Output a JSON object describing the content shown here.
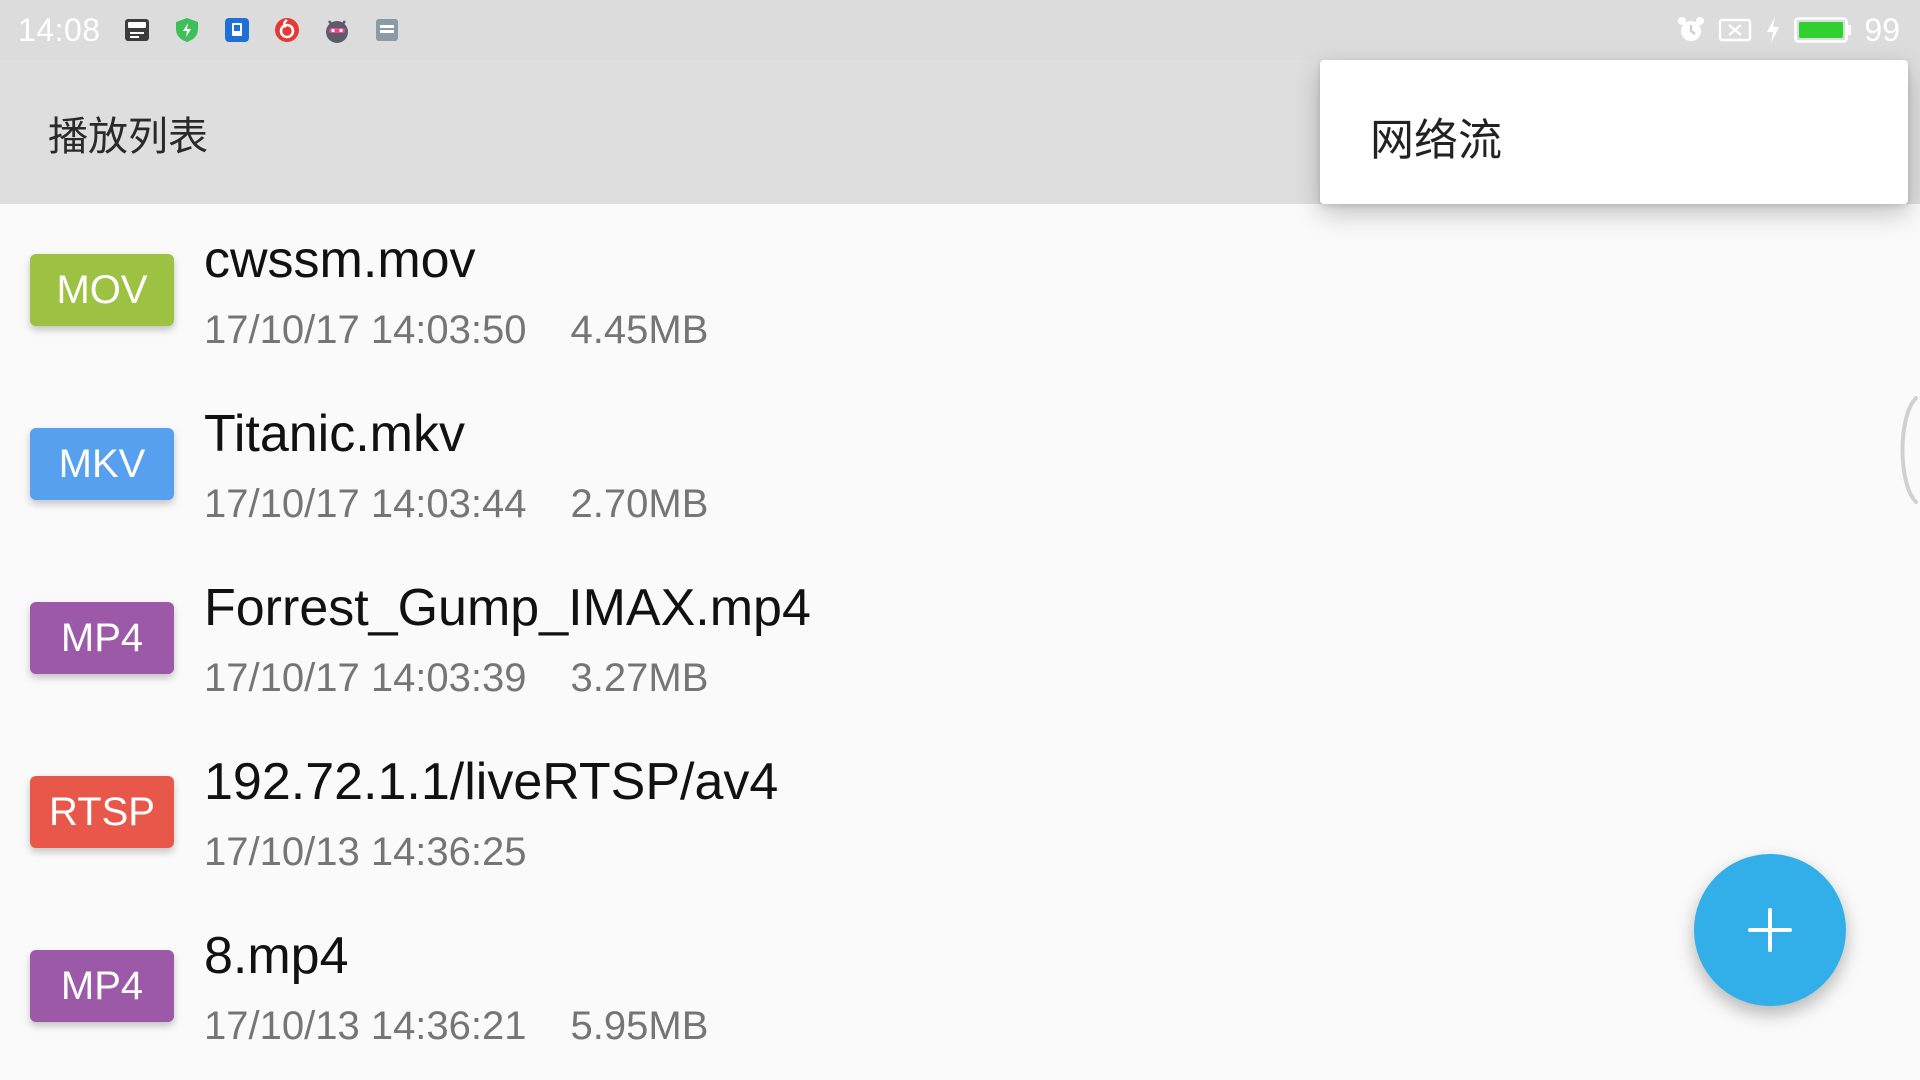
{
  "status_bar": {
    "time": "14:08",
    "notification_icons": [
      "usb-debug-icon",
      "security-shield-icon",
      "blue-app-icon",
      "netease-music-icon",
      "android-bot-icon",
      "gallery-icon"
    ],
    "right_icons": [
      "alarm-icon",
      "no-sim-icon",
      "charging-bolt-icon",
      "battery-icon"
    ],
    "battery_percent": "99",
    "battery_color": "#2ed12e"
  },
  "app_bar": {
    "title": "播放列表"
  },
  "overflow_menu": {
    "items": [
      {
        "label": "网络流"
      }
    ]
  },
  "playlist": {
    "items": [
      {
        "type": "MOV",
        "type_color": "#9dc243",
        "name": "cwssm.mov",
        "date": "17/10/17 14:03:50",
        "size": "4.45MB"
      },
      {
        "type": "MKV",
        "type_color": "#57a0ee",
        "name": "Titanic.mkv",
        "date": "17/10/17 14:03:44",
        "size": "2.70MB"
      },
      {
        "type": "MP4",
        "type_color": "#9b59a8",
        "name": "Forrest_Gump_IMAX.mp4",
        "date": "17/10/17 14:03:39",
        "size": "3.27MB"
      },
      {
        "type": "RTSP",
        "type_color": "#e8584a",
        "name": "192.72.1.1/liveRTSP/av4",
        "date": "17/10/13 14:36:25",
        "size": ""
      },
      {
        "type": "MP4",
        "type_color": "#9b59a8",
        "name": "8.mp4",
        "date": "17/10/13 14:36:21",
        "size": "5.95MB"
      }
    ]
  },
  "fab": {
    "icon": "plus-icon",
    "color": "#32aee8"
  }
}
